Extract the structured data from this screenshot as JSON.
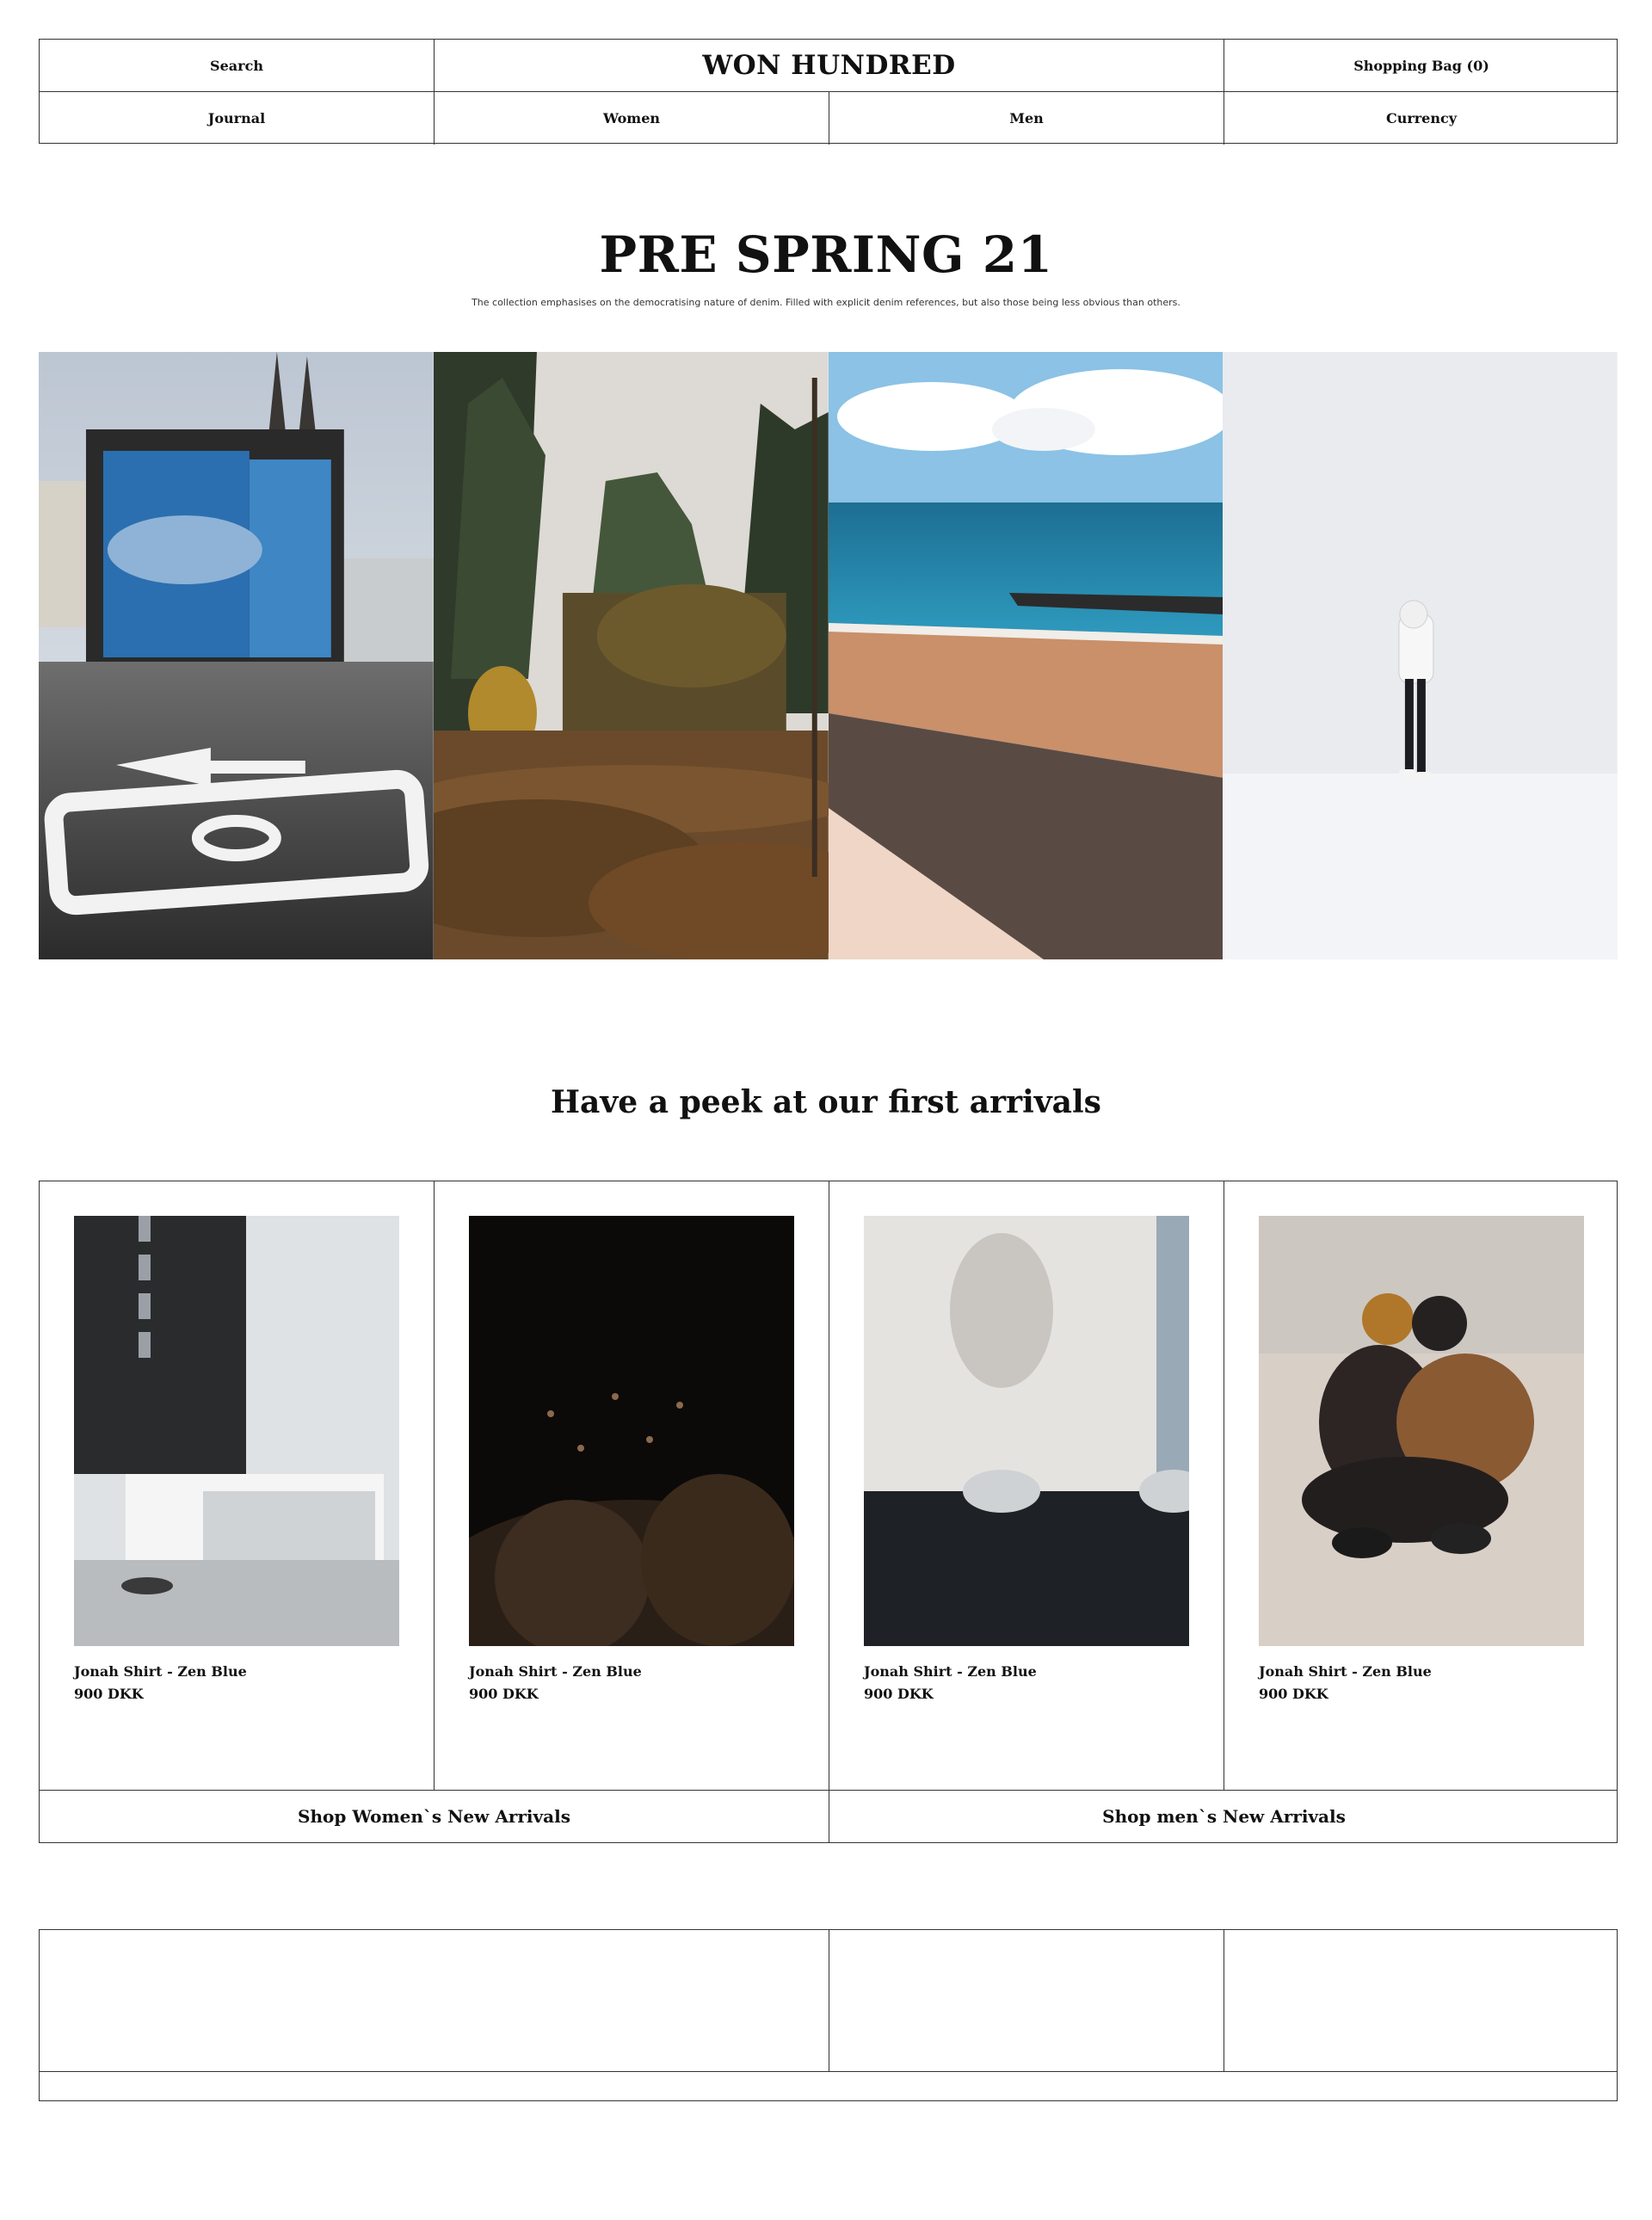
{
  "header": {
    "search_label": "Search",
    "brand": "WON HUNDRED",
    "bag_label": "Shopping Bag (0)",
    "nav": [
      {
        "label": "Journal"
      },
      {
        "label": "Women"
      },
      {
        "label": "Men"
      },
      {
        "label": "Currency"
      }
    ]
  },
  "hero": {
    "title": "PRE SPRING 21",
    "subtitle": "The collection emphasises on the democratising nature of denim. Filled with explicit denim references, but also those being less obvious than others."
  },
  "arrivals": {
    "title": "Have a peek at our first arrivals",
    "products": [
      {
        "name": "Jonah Shirt - Zen Blue",
        "price": "900 DKK"
      },
      {
        "name": "Jonah Shirt - Zen Blue",
        "price": "900 DKK"
      },
      {
        "name": "Jonah Shirt - Zen Blue",
        "price": "900 DKK"
      },
      {
        "name": "Jonah Shirt - Zen Blue",
        "price": "900 DKK"
      }
    ],
    "shop_women": "Shop Women`s New Arrivals",
    "shop_men": "Shop men`s New Arrivals"
  }
}
